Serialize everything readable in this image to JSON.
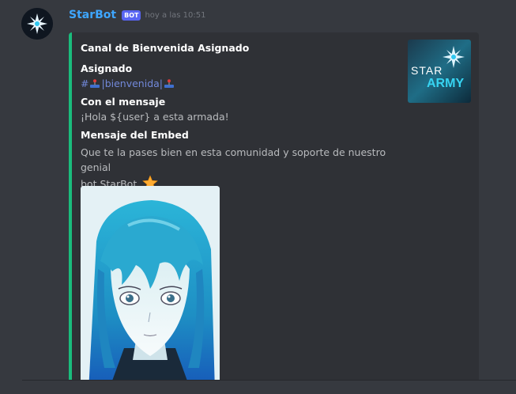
{
  "message": {
    "username": "StarBot",
    "bot_tag": "BOT",
    "timestamp": "hoy a las 10:51"
  },
  "embed": {
    "accent_color": "#1abc7c",
    "title": "Canal de Bienvenida Asignado",
    "fields": [
      {
        "name": "Asignado",
        "channel_prefix": "#",
        "channel_name": "|bienvenida|"
      },
      {
        "name": "Con el mensaje",
        "value": "¡Hola ${user} a esta armada!"
      },
      {
        "name": "Mensaje del Embed",
        "value_line1": "Que te la pases bien en esta comunidad y soporte de nuestro genial",
        "value_line2": "bot StarBot"
      }
    ],
    "thumbnail": {
      "text_star": "STAR",
      "text_army": "ARMY"
    },
    "emoji": "star-emoji"
  }
}
